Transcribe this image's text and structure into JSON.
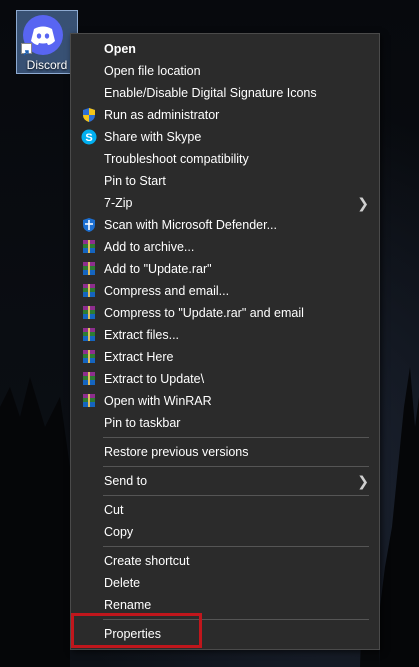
{
  "desktop": {
    "icon_label": "Discord",
    "icon_name": "discord-icon",
    "brand_color": "#5865f2"
  },
  "menu": {
    "items": [
      {
        "label": "Open",
        "bold": true,
        "icon": ""
      },
      {
        "label": "Open file location",
        "icon": ""
      },
      {
        "label": "Enable/Disable Digital Signature Icons",
        "icon": ""
      },
      {
        "label": "Run as administrator",
        "icon": "uac-shield-icon"
      },
      {
        "label": "Share with Skype",
        "icon": "skype-icon"
      },
      {
        "label": "Troubleshoot compatibility",
        "icon": ""
      },
      {
        "label": "Pin to Start",
        "icon": ""
      },
      {
        "label": "7-Zip",
        "icon": "",
        "submenu": true
      },
      {
        "label": "Scan with Microsoft Defender...",
        "icon": "defender-icon"
      },
      {
        "label": "Add to archive...",
        "icon": "winrar-icon"
      },
      {
        "label": "Add to \"Update.rar\"",
        "icon": "winrar-icon"
      },
      {
        "label": "Compress and email...",
        "icon": "winrar-icon"
      },
      {
        "label": "Compress to \"Update.rar\" and email",
        "icon": "winrar-icon"
      },
      {
        "label": "Extract files...",
        "icon": "winrar-icon"
      },
      {
        "label": "Extract Here",
        "icon": "winrar-icon"
      },
      {
        "label": "Extract to Update\\",
        "icon": "winrar-icon"
      },
      {
        "label": "Open with WinRAR",
        "icon": "winrar-icon"
      },
      {
        "label": "Pin to taskbar",
        "icon": ""
      },
      {
        "label": "Restore previous versions",
        "icon": ""
      },
      {
        "label": "Send to",
        "icon": "",
        "submenu": true
      },
      {
        "label": "Cut",
        "icon": ""
      },
      {
        "label": "Copy",
        "icon": ""
      },
      {
        "label": "Create shortcut",
        "icon": ""
      },
      {
        "label": "Delete",
        "icon": ""
      },
      {
        "label": "Rename",
        "icon": ""
      },
      {
        "label": "Properties",
        "icon": ""
      }
    ],
    "highlighted_item": "Properties",
    "highlight_color": "#c0161c"
  }
}
